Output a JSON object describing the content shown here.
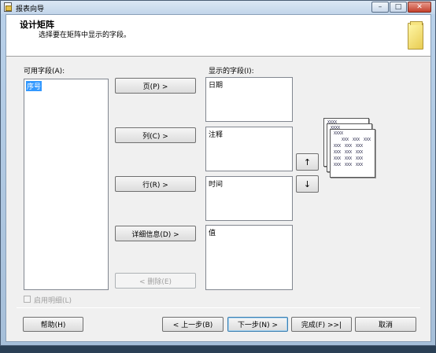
{
  "window": {
    "title": "报表向导",
    "controls": {
      "minimize": "–",
      "maximize": "□",
      "close": "✕"
    }
  },
  "header": {
    "title": "设计矩阵",
    "subtitle": "选择要在矩阵中显示的字段。"
  },
  "available_fields": {
    "label": "可用字段(A):",
    "items": [
      "序号"
    ],
    "selected_index": 0
  },
  "move_buttons": {
    "page": "页(P) >",
    "column": "列(C) >",
    "row": "行(R) >",
    "details": "详细信息(D) >",
    "remove": "< 删除(E)"
  },
  "displayed_fields": {
    "label": "显示的字段(I):",
    "page_box": [
      "日期"
    ],
    "column_box": [
      "注释"
    ],
    "row_box": [
      "时间"
    ],
    "details_box": [
      "值"
    ]
  },
  "order_buttons": {
    "up": "↑",
    "down": "↓"
  },
  "preview": {
    "row_label_text": "XXXX",
    "cell_text": "XXX"
  },
  "enable_drilldown": {
    "label": "启用明细(L)",
    "checked": false,
    "enabled": false
  },
  "footer": {
    "help": "帮助(H)",
    "back": "< 上一步(B)",
    "next": "下一步(N) >",
    "finish": "完成(F) >>|",
    "cancel": "取消"
  }
}
